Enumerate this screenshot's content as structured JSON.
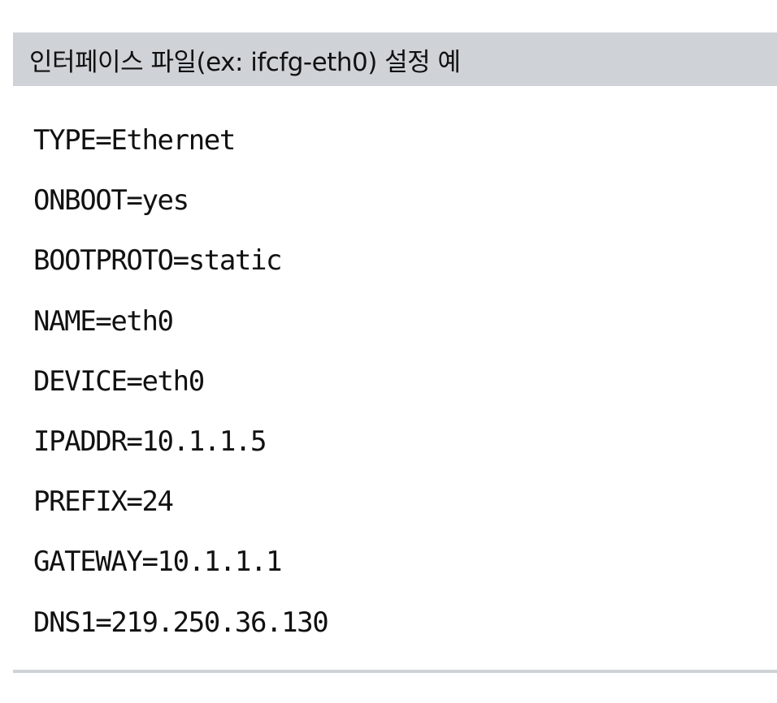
{
  "header": {
    "title": "인터페이스 파일(ex: ifcfg-eth0) 설정 예"
  },
  "config_lines": [
    "TYPE=Ethernet",
    "ONBOOT=yes",
    "BOOTPROTO=static",
    "NAME=eth0",
    "DEVICE=eth0",
    "IPADDR=10.1.1.5",
    "PREFIX=24",
    "GATEWAY=10.1.1.1",
    "DNS1=219.250.36.130"
  ],
  "colors": {
    "header_bg": "#cfd3d8",
    "text": "#111111"
  }
}
